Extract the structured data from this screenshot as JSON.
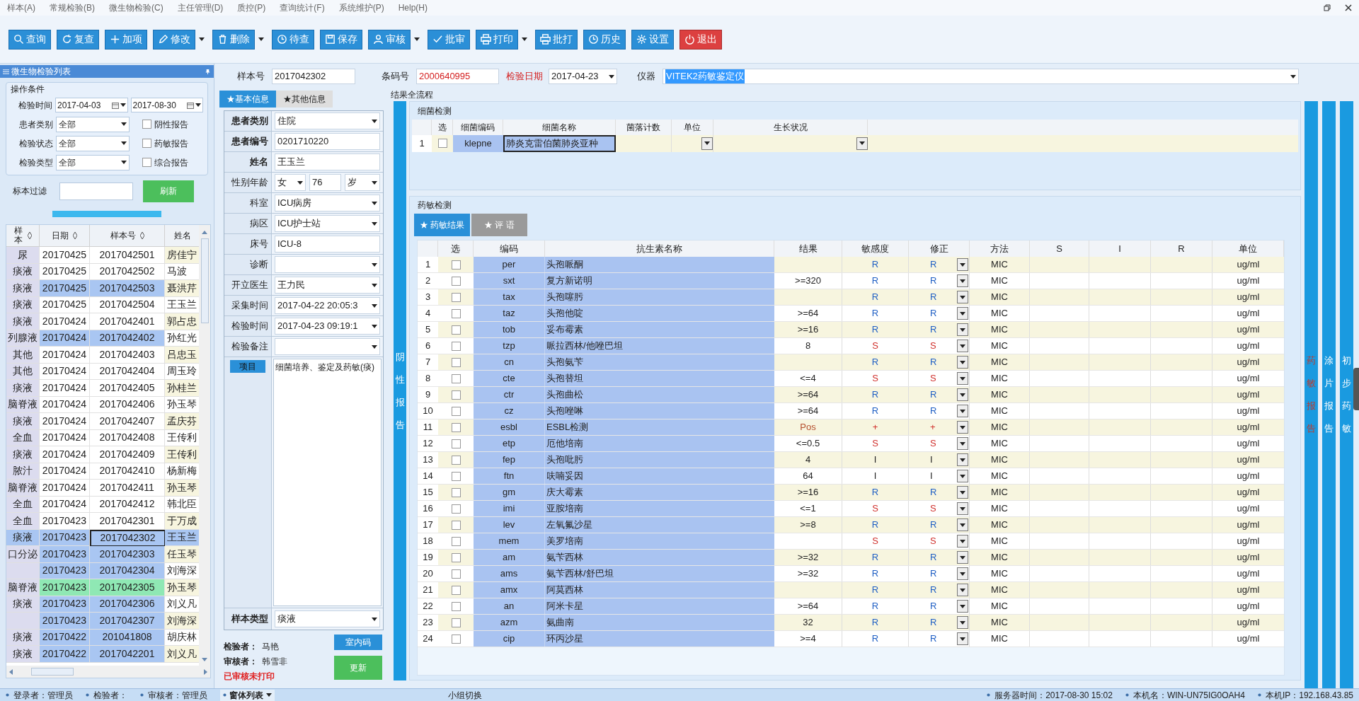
{
  "menu": [
    "样本(A)",
    "常规检验(B)",
    "微生物检验(C)",
    "主任管理(D)",
    "质控(P)",
    "查询统计(F)",
    "系统维护(P)",
    "Help(H)"
  ],
  "toolbar": [
    {
      "label": "查询",
      "dropdown": false,
      "kind": "normal"
    },
    {
      "label": "复查",
      "dropdown": false,
      "kind": "normal"
    },
    {
      "label": "加项",
      "dropdown": false,
      "kind": "normal"
    },
    {
      "label": "修改",
      "dropdown": true,
      "kind": "normal"
    },
    {
      "label": "删除",
      "dropdown": true,
      "kind": "normal"
    },
    {
      "label": "待查",
      "dropdown": false,
      "kind": "normal"
    },
    {
      "label": "保存",
      "dropdown": false,
      "kind": "normal"
    },
    {
      "label": "审核",
      "dropdown": true,
      "kind": "normal"
    },
    {
      "label": "批审",
      "dropdown": false,
      "kind": "normal"
    },
    {
      "label": "打印",
      "dropdown": true,
      "kind": "normal"
    },
    {
      "label": "批打",
      "dropdown": false,
      "kind": "normal"
    },
    {
      "label": "历史",
      "dropdown": false,
      "kind": "normal"
    },
    {
      "label": "设置",
      "dropdown": false,
      "kind": "normal"
    },
    {
      "label": "退出",
      "dropdown": false,
      "kind": "danger"
    }
  ],
  "list_panel": {
    "title": "微生物检验列表",
    "group_title": "操作条件",
    "date_label": "检验时间",
    "date_from": "2017-04-03",
    "date_to": "2017-08-30",
    "filters": [
      {
        "label": "患者类别",
        "value": "全部"
      },
      {
        "label": "检验状态",
        "value": "全部"
      },
      {
        "label": "检验类型",
        "value": "全部"
      }
    ],
    "checkboxes": [
      {
        "label": "阴性报告",
        "checked": false
      },
      {
        "label": "药敏报告",
        "checked": false
      },
      {
        "label": "综合报告",
        "checked": false
      }
    ],
    "filter_label": "标本过滤",
    "refresh": "刷新",
    "progress": {
      "level": 1
    },
    "columns": [
      "样本",
      "日期",
      "样本号",
      "姓名"
    ],
    "rows": [
      {
        "type": "尿",
        "date": "20170425",
        "no": "2017042501",
        "name": "房佳宁",
        "color": "#ffffff",
        "selected": false
      },
      {
        "type": "痰液",
        "date": "20170425",
        "no": "2017042502",
        "name": "马波",
        "color": "#ffffff",
        "selected": false
      },
      {
        "type": "痰液",
        "date": "20170425",
        "no": "2017042503",
        "name": "聂洪芹",
        "color": "#a9c6f2",
        "selected": false
      },
      {
        "type": "痰液",
        "date": "20170425",
        "no": "2017042504",
        "name": "王玉兰",
        "color": "#ffffff",
        "selected": false
      },
      {
        "type": "痰液",
        "date": "20170424",
        "no": "2017042401",
        "name": "郭占忠",
        "color": "#ffffff",
        "selected": false
      },
      {
        "type": "列腺液",
        "date": "20170424",
        "no": "2017042402",
        "name": "孙红光",
        "color": "#a9c6f2",
        "selected": false
      },
      {
        "type": "其他",
        "date": "20170424",
        "no": "2017042403",
        "name": "吕忠玉",
        "color": "#ffffff",
        "selected": false
      },
      {
        "type": "其他",
        "date": "20170424",
        "no": "2017042404",
        "name": "周玉玲",
        "color": "#ffffff",
        "selected": false
      },
      {
        "type": "痰液",
        "date": "20170424",
        "no": "2017042405",
        "name": "孙桂兰",
        "color": "#ffffff",
        "selected": false
      },
      {
        "type": "脑脊液",
        "date": "20170424",
        "no": "2017042406",
        "name": "孙玉琴",
        "color": "#ffffff",
        "selected": false
      },
      {
        "type": "痰液",
        "date": "20170424",
        "no": "2017042407",
        "name": "孟庆芬",
        "color": "#ffffff",
        "selected": false
      },
      {
        "type": "全血",
        "date": "20170424",
        "no": "2017042408",
        "name": "王传利",
        "color": "#ffffff",
        "selected": false
      },
      {
        "type": "痰液",
        "date": "20170424",
        "no": "2017042409",
        "name": "王传利",
        "color": "#ffffff",
        "selected": false
      },
      {
        "type": "脓汁",
        "date": "20170424",
        "no": "2017042410",
        "name": "杨新梅",
        "color": "#ffffff",
        "selected": false
      },
      {
        "type": "脑脊液",
        "date": "20170424",
        "no": "2017042411",
        "name": "孙玉琴",
        "color": "#ffffff",
        "selected": false
      },
      {
        "type": "全血",
        "date": "20170424",
        "no": "2017042412",
        "name": "韩北臣",
        "color": "#ffffff",
        "selected": false
      },
      {
        "type": "全血",
        "date": "20170423",
        "no": "2017042301",
        "name": "于万成",
        "color": "#ffffff",
        "selected": false
      },
      {
        "type": "痰液",
        "date": "20170423",
        "no": "2017042302",
        "name": "王玉兰",
        "color": "#a9c6f2",
        "selected": true
      },
      {
        "type": "口分泌",
        "date": "20170423",
        "no": "2017042303",
        "name": "任玉琴",
        "color": "#a9c6f2",
        "selected": false
      },
      {
        "date": "20170423",
        "no": "2017042304",
        "name": "刘海深",
        "color": "#a9c6f2",
        "selected": false
      },
      {
        "type": "脑脊液",
        "date": "20170423",
        "no": "2017042305",
        "name": "孙玉琴",
        "color": "#8fe8b4",
        "selected": false
      },
      {
        "type": "痰液",
        "date": "20170423",
        "no": "2017042306",
        "name": "刘义凡",
        "color": "#a9c6f2",
        "selected": false
      },
      {
        "date": "20170423",
        "no": "2017042307",
        "name": "刘海深",
        "color": "#a9c6f2",
        "selected": false
      },
      {
        "type": "痰液",
        "date": "20170422",
        "no": "201041808",
        "name": "胡庆林",
        "color": "#a9c6f2",
        "selected": false
      },
      {
        "type": "痰液",
        "date": "20170422",
        "no": "2017042201",
        "name": "刘义凡",
        "color": "#a9c6f2",
        "selected": false
      }
    ]
  },
  "header": {
    "sample_no_label": "样本号",
    "sample_no": "2017042302",
    "barcode_label": "条码号",
    "barcode": "2000640995",
    "date_label": "检验日期",
    "date": "2017-04-23",
    "instrument_label": "仪器",
    "instrument": "VITEK2药敏鉴定仪"
  },
  "patient_tabs": [
    {
      "label": "★基本信息",
      "selected": true
    },
    {
      "label": "★其他信息",
      "selected": false
    }
  ],
  "patient_fields": [
    {
      "kind": "select",
      "label": "患者类别",
      "value": "住院",
      "required": true
    },
    {
      "kind": "input",
      "label": "患者编号",
      "value": "0201710220",
      "required": true
    },
    {
      "kind": "input",
      "label": "姓名",
      "value": "王玉兰",
      "required": true
    },
    {
      "kind": "sex_age",
      "label": "性别年龄",
      "sex": "女",
      "age": "76",
      "unit": "岁",
      "required": false
    },
    {
      "kind": "select",
      "label": "科室",
      "value": "ICU病房",
      "required": false
    },
    {
      "kind": "select",
      "label": "病区",
      "value": "ICU护士站",
      "required": false
    },
    {
      "kind": "input",
      "label": "床号",
      "value": "ICU-8",
      "required": false
    },
    {
      "kind": "select",
      "label": "诊断",
      "required": false
    },
    {
      "kind": "select",
      "label": "开立医生",
      "value": "王力民",
      "required": false
    },
    {
      "kind": "select",
      "label": "采集时间",
      "value": "2017-04-22 20:05:3",
      "required": false
    },
    {
      "kind": "select",
      "label": "检验时间",
      "value": "2017-04-23 09:19:1",
      "required": false
    },
    {
      "kind": "select",
      "label": "检验备注",
      "required": false
    }
  ],
  "items": {
    "label": "项目",
    "text": "细菌培养、鉴定及药敏(痰)"
  },
  "sample_type": {
    "label": "样本类型",
    "value": "痰液"
  },
  "inspector": {
    "label": "检验者：",
    "value": "马艳"
  },
  "reviewer": {
    "label": "审核者：",
    "value": "韩雪非"
  },
  "audit_status": "已审核未打印",
  "form_buttons": [
    {
      "label": "室内码",
      "kind": "blue"
    },
    {
      "label": "更新",
      "kind": "green"
    }
  ],
  "results": {
    "title": "结果全流程",
    "side_tab": "阴性报告",
    "bacteria": {
      "title": "细菌检测",
      "columns": [
        "选",
        "细菌编码",
        "细菌名称",
        "菌落计数",
        "单位",
        "生长状况"
      ],
      "rows": [
        {
          "no": "1",
          "checked": false,
          "code": "klepne",
          "name": "肺炎克雷伯菌肺炎亚种"
        }
      ]
    },
    "sensitivity": {
      "title": "药敏检测",
      "tabs": [
        {
          "label": "★ 药敏结果",
          "selected": true
        },
        {
          "label": "★ 评 语",
          "selected": false
        }
      ],
      "columns": [
        "选",
        "编码",
        "抗生素名称",
        "结果",
        "敏感度",
        "修正",
        "方法",
        "S",
        "I",
        "R",
        "单位"
      ],
      "rows": [
        {
          "no": "1",
          "checked": false,
          "code": "per",
          "name": "头孢哌酮",
          "sensitivity": "R",
          "correction": "R",
          "color": "#1f5fc4",
          "method": "MIC",
          "unit": "ug/ml"
        },
        {
          "no": "2",
          "checked": false,
          "code": "sxt",
          "name": "复方新诺明",
          "result": ">=320",
          "sensitivity": "R",
          "correction": "R",
          "color": "#1f5fc4",
          "positive": false,
          "method": "MIC",
          "unit": "ug/ml"
        },
        {
          "no": "3",
          "checked": false,
          "code": "tax",
          "name": "头孢噻肟",
          "sensitivity": "R",
          "correction": "R",
          "color": "#1f5fc4",
          "method": "MIC",
          "unit": "ug/ml"
        },
        {
          "no": "4",
          "checked": false,
          "code": "taz",
          "name": "头孢他啶",
          "result": ">=64",
          "sensitivity": "R",
          "correction": "R",
          "color": "#1f5fc4",
          "positive": false,
          "method": "MIC",
          "unit": "ug/ml"
        },
        {
          "no": "5",
          "checked": false,
          "code": "tob",
          "name": "妥布霉素",
          "result": ">=16",
          "sensitivity": "R",
          "correction": "R",
          "color": "#1f5fc4",
          "positive": false,
          "method": "MIC",
          "unit": "ug/ml"
        },
        {
          "no": "6",
          "checked": false,
          "code": "tzp",
          "name": "哌拉西林/他唑巴坦",
          "result": "8",
          "sensitivity": "S",
          "correction": "S",
          "color": "#d0302c",
          "positive": false,
          "method": "MIC",
          "unit": "ug/ml"
        },
        {
          "no": "7",
          "checked": false,
          "code": "cn",
          "name": "头孢氨苄",
          "sensitivity": "R",
          "correction": "R",
          "color": "#1f5fc4",
          "method": "MIC",
          "unit": "ug/ml"
        },
        {
          "no": "8",
          "checked": false,
          "code": "cte",
          "name": "头孢替坦",
          "result": "<=4",
          "sensitivity": "S",
          "correction": "S",
          "color": "#d0302c",
          "positive": false,
          "method": "MIC",
          "unit": "ug/ml"
        },
        {
          "no": "9",
          "checked": false,
          "code": "ctr",
          "name": "头孢曲松",
          "result": ">=64",
          "sensitivity": "R",
          "correction": "R",
          "color": "#1f5fc4",
          "positive": false,
          "method": "MIC",
          "unit": "ug/ml"
        },
        {
          "no": "10",
          "checked": false,
          "code": "cz",
          "name": "头孢唑啉",
          "result": ">=64",
          "sensitivity": "R",
          "correction": "R",
          "color": "#1f5fc4",
          "positive": false,
          "method": "MIC",
          "unit": "ug/ml"
        },
        {
          "no": "11",
          "checked": false,
          "code": "esbl",
          "name": "ESBL检测",
          "result": "Pos",
          "sensitivity": "+",
          "correction": "+",
          "color": "#d0302c",
          "positive": true,
          "method": "MIC",
          "unit": "ug/ml"
        },
        {
          "no": "12",
          "checked": false,
          "code": "etp",
          "name": "厄他培南",
          "result": "<=0.5",
          "sensitivity": "S",
          "correction": "S",
          "color": "#d0302c",
          "positive": false,
          "method": "MIC",
          "unit": "ug/ml"
        },
        {
          "no": "13",
          "checked": false,
          "code": "fep",
          "name": "头孢吡肟",
          "result": "4",
          "sensitivity": "I",
          "correction": "I",
          "color": "#222222",
          "positive": false,
          "method": "MIC",
          "unit": "ug/ml"
        },
        {
          "no": "14",
          "checked": false,
          "code": "ftn",
          "name": "呋喃妥因",
          "result": "64",
          "sensitivity": "I",
          "correction": "I",
          "color": "#222222",
          "positive": false,
          "method": "MIC",
          "unit": "ug/ml"
        },
        {
          "no": "15",
          "checked": false,
          "code": "gm",
          "name": "庆大霉素",
          "result": ">=16",
          "sensitivity": "R",
          "correction": "R",
          "color": "#1f5fc4",
          "positive": false,
          "method": "MIC",
          "unit": "ug/ml"
        },
        {
          "no": "16",
          "checked": false,
          "code": "imi",
          "name": "亚胺培南",
          "result": "<=1",
          "sensitivity": "S",
          "correction": "S",
          "color": "#d0302c",
          "positive": false,
          "method": "MIC",
          "unit": "ug/ml"
        },
        {
          "no": "17",
          "checked": false,
          "code": "lev",
          "name": "左氧氟沙星",
          "result": ">=8",
          "sensitivity": "R",
          "correction": "R",
          "color": "#1f5fc4",
          "positive": false,
          "method": "MIC",
          "unit": "ug/ml"
        },
        {
          "no": "18",
          "checked": false,
          "code": "mem",
          "name": "美罗培南",
          "sensitivity": "S",
          "correction": "S",
          "color": "#d0302c",
          "method": "MIC",
          "unit": "ug/ml"
        },
        {
          "no": "19",
          "checked": false,
          "code": "am",
          "name": "氨苄西林",
          "result": ">=32",
          "sensitivity": "R",
          "correction": "R",
          "color": "#1f5fc4",
          "positive": false,
          "method": "MIC",
          "unit": "ug/ml"
        },
        {
          "no": "20",
          "checked": false,
          "code": "ams",
          "name": "氨苄西林/舒巴坦",
          "result": ">=32",
          "sensitivity": "R",
          "correction": "R",
          "color": "#1f5fc4",
          "positive": false,
          "method": "MIC",
          "unit": "ug/ml"
        },
        {
          "no": "21",
          "checked": false,
          "code": "amx",
          "name": "阿莫西林",
          "sensitivity": "R",
          "correction": "R",
          "color": "#1f5fc4",
          "method": "MIC",
          "unit": "ug/ml"
        },
        {
          "no": "22",
          "checked": false,
          "code": "an",
          "name": "阿米卡星",
          "result": ">=64",
          "sensitivity": "R",
          "correction": "R",
          "color": "#1f5fc4",
          "positive": false,
          "method": "MIC",
          "unit": "ug/ml"
        },
        {
          "no": "23",
          "checked": false,
          "code": "azm",
          "name": "氨曲南",
          "result": "32",
          "sensitivity": "R",
          "correction": "R",
          "color": "#1f5fc4",
          "positive": false,
          "method": "MIC",
          "unit": "ug/ml"
        },
        {
          "no": "24",
          "checked": false,
          "code": "cip",
          "name": "环丙沙星",
          "result": ">=4",
          "sensitivity": "R",
          "correction": "R",
          "color": "#1f5fc4",
          "positive": false,
          "method": "MIC",
          "unit": "ug/ml"
        }
      ]
    }
  },
  "report_tabs": [
    {
      "label": "药敏报告",
      "selected": true
    },
    {
      "label": "涂片报告",
      "selected": false
    },
    {
      "label": "初步药敏",
      "selected": false
    }
  ],
  "status_bar": {
    "left": [
      "登录者：管理员",
      "检验者：",
      "审核者：管理员"
    ],
    "menu": "窗体列表",
    "center": "小组切换",
    "right": [
      "服务器时间：2017-08-30 15:02",
      "本机名：WIN-UN75IG0OAH4",
      "本机IP：192.168.43.85"
    ]
  }
}
